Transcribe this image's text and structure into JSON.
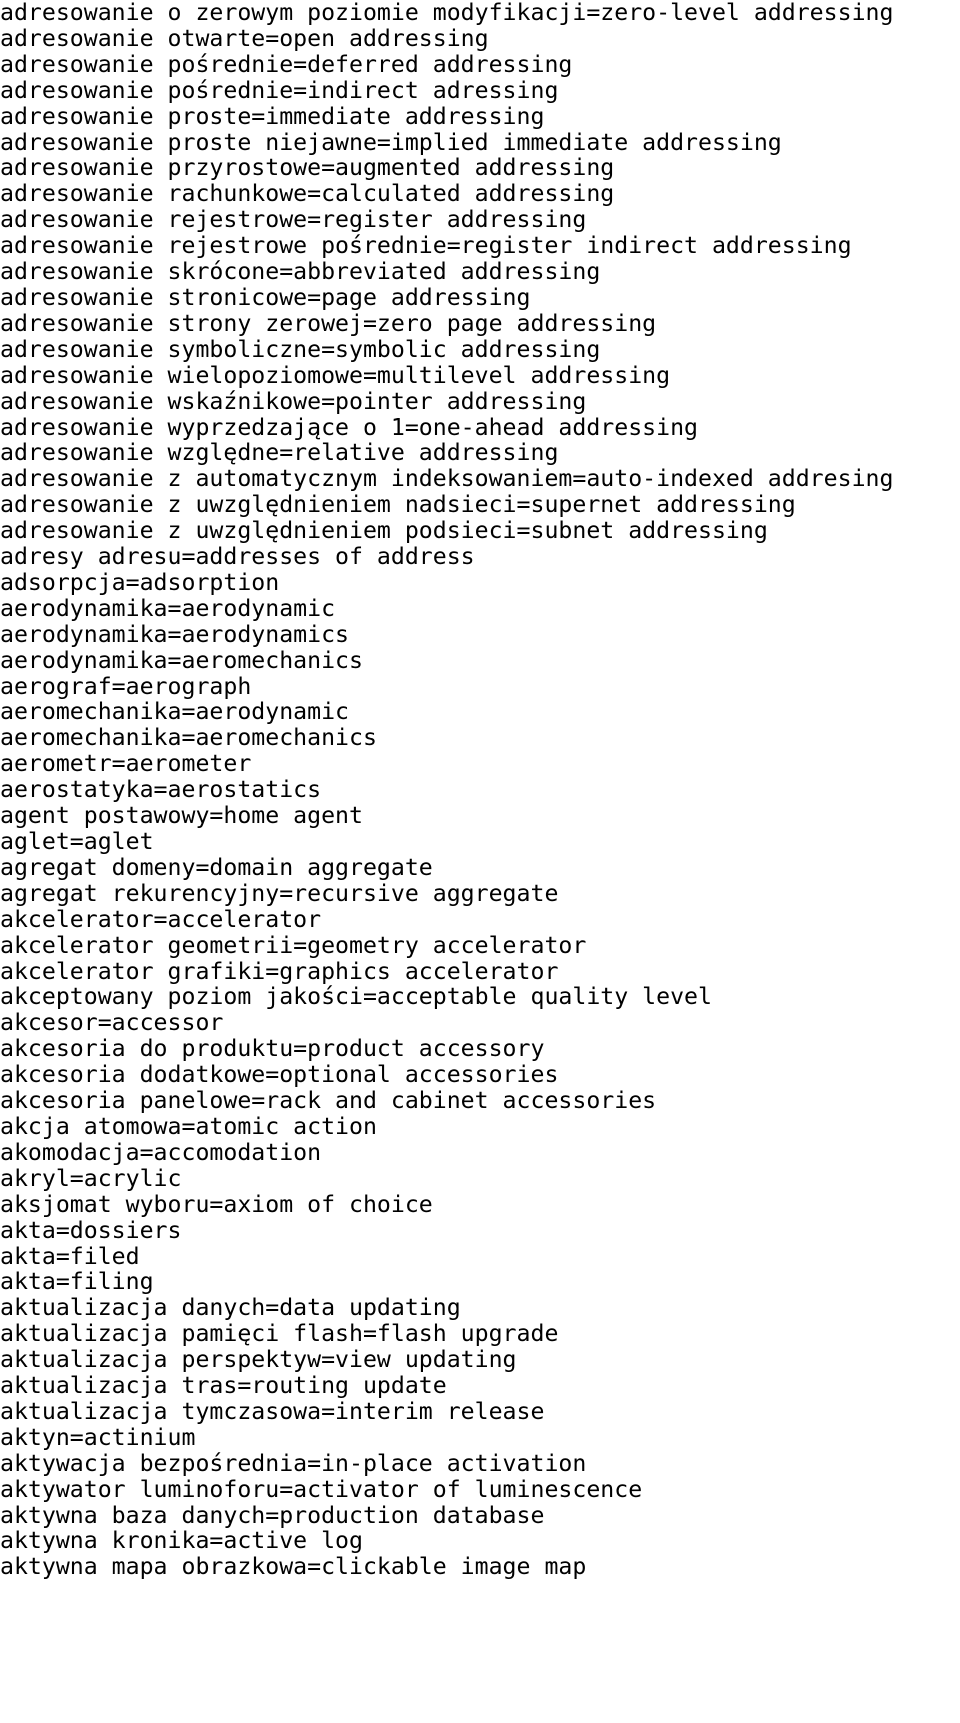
{
  "document": {
    "type": "glossary-term-list",
    "language_pair": "Polish=English",
    "separator": "=",
    "text_color": "#000000",
    "background_color": "#ffffff",
    "entries": [
      "adresowanie o zerowym poziomie modyfikacji=zero-level addressing",
      "adresowanie otwarte=open addressing",
      "adresowanie pośrednie=deferred addressing",
      "adresowanie pośrednie=indirect adressing",
      "adresowanie proste=immediate addressing",
      "adresowanie proste niejawne=implied immediate addressing",
      "adresowanie przyrostowe=augmented addressing",
      "adresowanie rachunkowe=calculated addressing",
      "adresowanie rejestrowe=register addressing",
      "adresowanie rejestrowe pośrednie=register indirect addressing",
      "adresowanie skrócone=abbreviated addressing",
      "adresowanie stronicowe=page addressing",
      "adresowanie strony zerowej=zero page addressing",
      "adresowanie symboliczne=symbolic addressing",
      "adresowanie wielopoziomowe=multilevel addressing",
      "adresowanie wskaźnikowe=pointer addressing",
      "adresowanie wyprzedzające o 1=one-ahead addressing",
      "adresowanie względne=relative addressing",
      "adresowanie z automatycznym indeksowaniem=auto-indexed addresing",
      "adresowanie z uwzględnieniem nadsieci=supernet addressing",
      "adresowanie z uwzględnieniem podsieci=subnet addressing",
      "adresy adresu=addresses of address",
      "adsorpcja=adsorption",
      "aerodynamika=aerodynamic",
      "aerodynamika=aerodynamics",
      "aerodynamika=aeromechanics",
      "aerograf=aerograph",
      "aeromechanika=aerodynamic",
      "aeromechanika=aeromechanics",
      "aerometr=aerometer",
      "aerostatyka=aerostatics",
      "agent postawowy=home agent",
      "aglet=aglet",
      "agregat domeny=domain aggregate",
      "agregat rekurencyjny=recursive aggregate",
      "akcelerator=accelerator",
      "akcelerator geometrii=geometry accelerator",
      "akcelerator grafiki=graphics accelerator",
      "akceptowany poziom jakości=acceptable quality level",
      "akcesor=accessor",
      "akcesoria do produktu=product accessory",
      "akcesoria dodatkowe=optional accessories",
      "akcesoria panelowe=rack and cabinet accessories",
      "akcja atomowa=atomic action",
      "akomodacja=accomodation",
      "akryl=acrylic",
      "aksjomat wyboru=axiom of choice",
      "akta=dossiers",
      "akta=filed",
      "akta=filing",
      "aktualizacja danych=data updating",
      "aktualizacja pamięci flash=flash upgrade",
      "aktualizacja perspektyw=view updating",
      "aktualizacja tras=routing update",
      "aktualizacja tymczasowa=interim release",
      "aktyn=actinium",
      "aktywacja bezpośrednia=in-place activation",
      "aktywator luminoforu=activator of luminescence",
      "aktywna baza danych=production database",
      "aktywna kronika=active log",
      "aktywna mapa obrazkowa=clickable image map"
    ]
  }
}
